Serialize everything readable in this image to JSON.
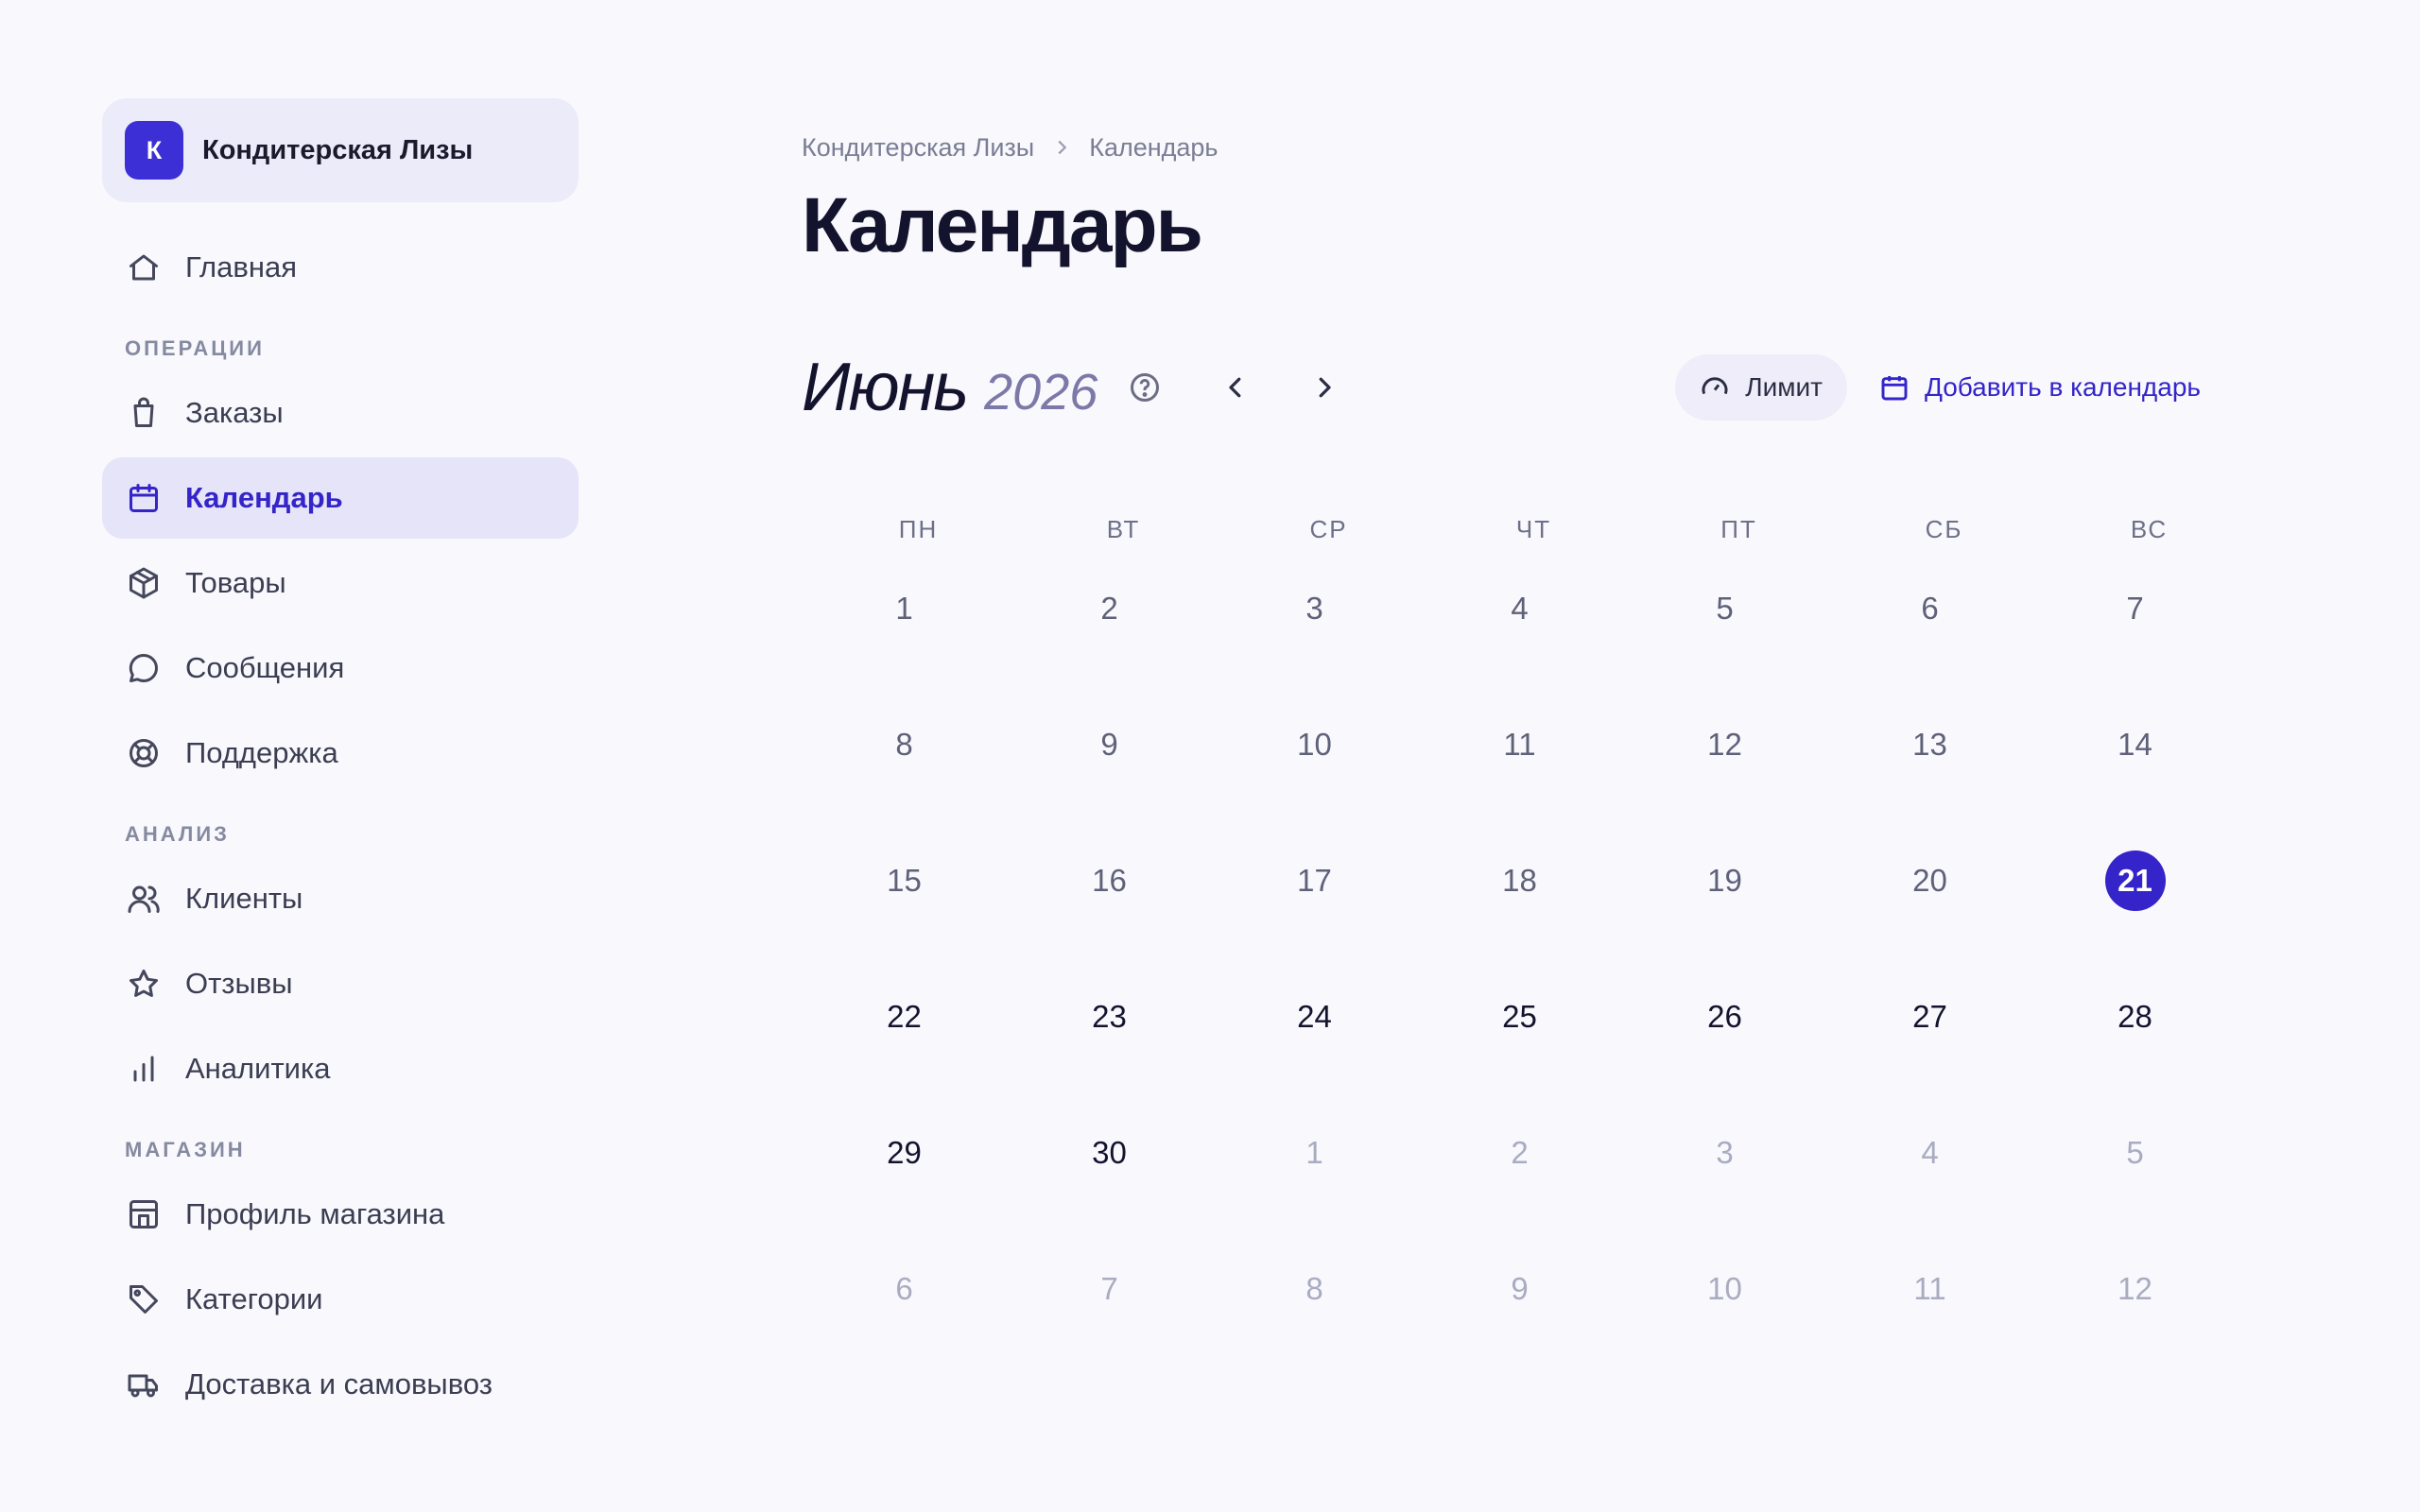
{
  "store": {
    "initial": "К",
    "name": "Кондитерская Лизы"
  },
  "sidebar": {
    "home": "Главная",
    "sections": {
      "operations": "ОПЕРАЦИИ",
      "analysis": "АНАЛИЗ",
      "shop": "МАГАЗИН"
    },
    "items": {
      "orders": "Заказы",
      "calendar": "Календарь",
      "products": "Товары",
      "messages": "Сообщения",
      "support": "Поддержка",
      "clients": "Клиенты",
      "reviews": "Отзывы",
      "analytics": "Аналитика",
      "store_profile": "Профиль магазина",
      "categories": "Категории",
      "delivery": "Доставка и самовывоз"
    },
    "active_item": "calendar"
  },
  "breadcrumb": {
    "root": "Кондитерская Лизы",
    "current": "Календарь"
  },
  "page": {
    "title": "Календарь"
  },
  "calendar": {
    "month": "Июнь",
    "year": "2026",
    "limit_label": "Лимит",
    "add_label": "Добавить в календарь",
    "weekdays": [
      "ПН",
      "ВТ",
      "СР",
      "ЧТ",
      "ПТ",
      "СБ",
      "ВС"
    ],
    "today": 21,
    "days": [
      [
        "1",
        "2",
        "3",
        "4",
        "5",
        "6",
        "7"
      ],
      [
        "8",
        "9",
        "10",
        "11",
        "12",
        "13",
        "14"
      ],
      [
        "15",
        "16",
        "17",
        "18",
        "19",
        "20",
        "21"
      ],
      [
        "22",
        "23",
        "24",
        "25",
        "26",
        "27",
        "28"
      ],
      [
        "29",
        "30",
        "1",
        "2",
        "3",
        "4",
        "5"
      ],
      [
        "6",
        "7",
        "8",
        "9",
        "10",
        "11",
        "12"
      ]
    ]
  },
  "colors": {
    "accent": "#3424c9",
    "background": "#f8f8fd",
    "active_nav_bg": "#e6e4f8"
  }
}
